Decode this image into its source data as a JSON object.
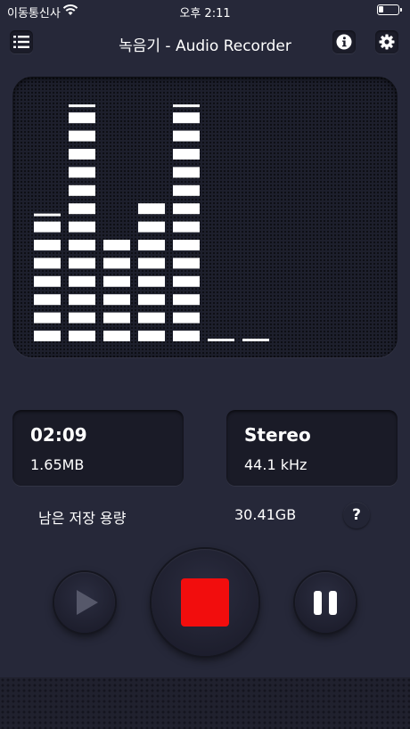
{
  "status_bar": {
    "carrier": "이동통신사",
    "time": "오후 2:11",
    "battery_level": 0.25
  },
  "nav": {
    "title": "녹음기 - Audio Recorder",
    "menu_icon": "list-icon",
    "info_icon": "info-icon",
    "settings_icon": "gear-icon"
  },
  "visualizer": {
    "channel_levels_segments": [
      7,
      13,
      6,
      8,
      13,
      0,
      0
    ],
    "peak_markers": [
      true,
      true,
      false,
      false,
      true,
      true,
      true
    ],
    "max_segments": 13
  },
  "recording": {
    "elapsed": "02:09",
    "file_size": "1.65MB"
  },
  "audio_format": {
    "channels": "Stereo",
    "sample_rate": "44.1 kHz"
  },
  "storage": {
    "label": "남은 저장 용량",
    "value": "30.41GB",
    "help_label": "?"
  },
  "controls": {
    "play_icon": "play-icon",
    "stop_icon": "stop-icon",
    "pause_icon": "pause-icon"
  },
  "colors": {
    "background": "#262839",
    "record_accent": "#f20d0d",
    "text": "#ffffff"
  }
}
